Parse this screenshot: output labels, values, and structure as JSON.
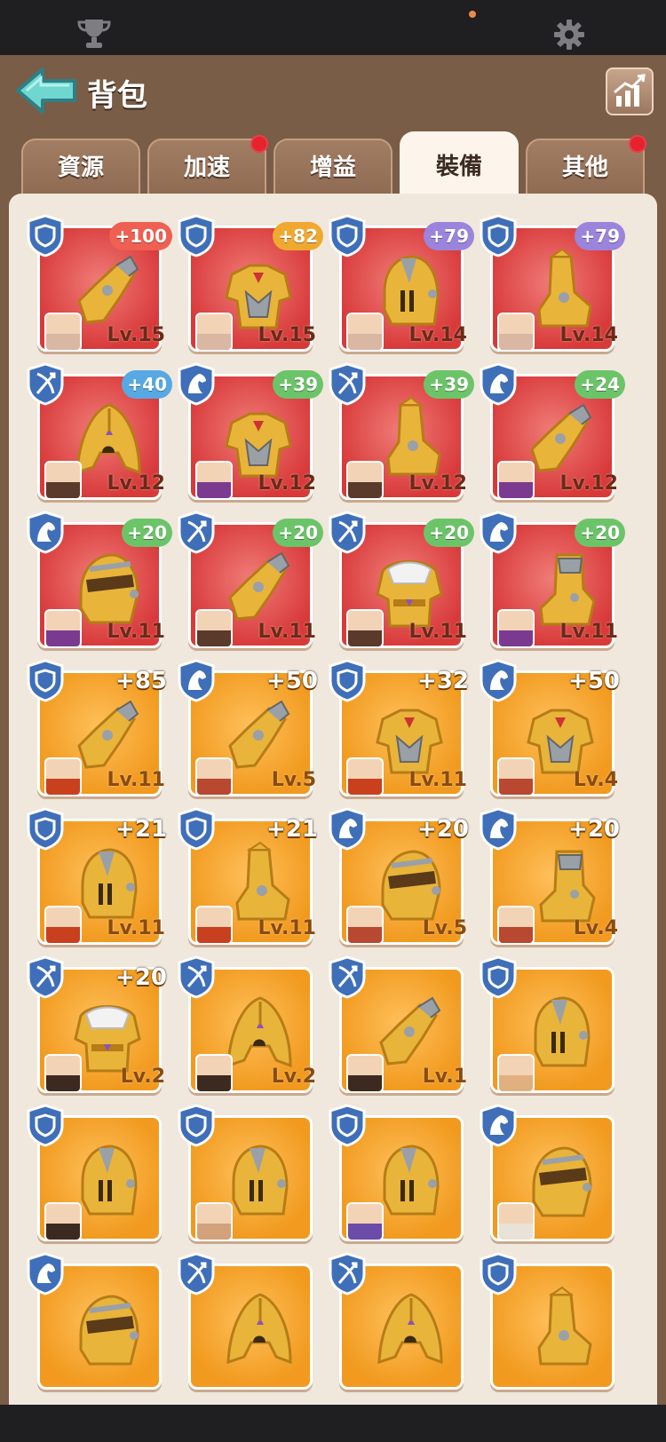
{
  "header": {
    "title": "背包"
  },
  "tabs": [
    {
      "label": "資源",
      "badge": false
    },
    {
      "label": "加速",
      "badge": true
    },
    {
      "label": "增益",
      "badge": false
    },
    {
      "label": "裝備",
      "badge": false,
      "active": true
    },
    {
      "label": "其他",
      "badge": true
    }
  ],
  "colors": {
    "accent": "#6fd7d0",
    "panel": "#7a5d47",
    "content": "#f0e7dd",
    "badge": "#e6222d"
  },
  "items": [
    {
      "role": "shield",
      "bonus": "+100",
      "bonus_style": "red",
      "level": "Lv.15",
      "rarity": "red",
      "gear": "gauntlet",
      "hero": "#d9b7a3"
    },
    {
      "role": "shield",
      "bonus": "+82",
      "bonus_style": "gold",
      "level": "Lv.15",
      "rarity": "red",
      "gear": "chest",
      "hero": "#d9b7a3"
    },
    {
      "role": "shield",
      "bonus": "+79",
      "bonus_style": "purple",
      "level": "Lv.14",
      "rarity": "red",
      "gear": "helmet",
      "hero": "#d9b7a3"
    },
    {
      "role": "shield",
      "bonus": "+79",
      "bonus_style": "purple",
      "level": "Lv.14",
      "rarity": "red",
      "gear": "boot",
      "hero": "#d9b7a3"
    },
    {
      "role": "bow",
      "bonus": "+40",
      "bonus_style": "blue",
      "level": "Lv.12",
      "rarity": "red",
      "gear": "hood",
      "hero": "#5a3a2a"
    },
    {
      "role": "horse",
      "bonus": "+39",
      "bonus_style": "green",
      "level": "Lv.12",
      "rarity": "red",
      "gear": "chest",
      "hero": "#7b3a8f"
    },
    {
      "role": "bow",
      "bonus": "+39",
      "bonus_style": "green",
      "level": "Lv.12",
      "rarity": "red",
      "gear": "boot",
      "hero": "#5a3a2a"
    },
    {
      "role": "horse",
      "bonus": "+24",
      "bonus_style": "green",
      "level": "Lv.12",
      "rarity": "red",
      "gear": "gauntlet",
      "hero": "#7b3a8f"
    },
    {
      "role": "horse",
      "bonus": "+20",
      "bonus_style": "green",
      "level": "Lv.11",
      "rarity": "red",
      "gear": "helmet2",
      "hero": "#7b3a8f"
    },
    {
      "role": "bow",
      "bonus": "+20",
      "bonus_style": "green",
      "level": "Lv.11",
      "rarity": "red",
      "gear": "gauntlet",
      "hero": "#5a3a2a"
    },
    {
      "role": "bow",
      "bonus": "+20",
      "bonus_style": "green",
      "level": "Lv.11",
      "rarity": "red",
      "gear": "chest2",
      "hero": "#5a3a2a"
    },
    {
      "role": "horse",
      "bonus": "+20",
      "bonus_style": "green",
      "level": "Lv.11",
      "rarity": "red",
      "gear": "boot2",
      "hero": "#7b3a8f"
    },
    {
      "role": "shield",
      "bonus": "+85",
      "bonus_style": "plain",
      "level": "Lv.11",
      "rarity": "orange",
      "gear": "gauntlet",
      "hero": "#c8401e"
    },
    {
      "role": "horse",
      "bonus": "+50",
      "bonus_style": "plain",
      "level": "Lv.5",
      "rarity": "orange",
      "gear": "gauntlet",
      "hero": "#b84830"
    },
    {
      "role": "shield",
      "bonus": "+32",
      "bonus_style": "plain",
      "level": "Lv.11",
      "rarity": "orange",
      "gear": "chest",
      "hero": "#c8401e"
    },
    {
      "role": "horse",
      "bonus": "+50",
      "bonus_style": "plain",
      "level": "Lv.4",
      "rarity": "orange",
      "gear": "chest",
      "hero": "#b84830"
    },
    {
      "role": "shield",
      "bonus": "+21",
      "bonus_style": "plain",
      "level": "Lv.11",
      "rarity": "orange",
      "gear": "helmet",
      "hero": "#c8401e"
    },
    {
      "role": "shield",
      "bonus": "+21",
      "bonus_style": "plain",
      "level": "Lv.11",
      "rarity": "orange",
      "gear": "boot",
      "hero": "#c8401e"
    },
    {
      "role": "horse",
      "bonus": "+20",
      "bonus_style": "plain",
      "level": "Lv.5",
      "rarity": "orange",
      "gear": "helmet2",
      "hero": "#b84830"
    },
    {
      "role": "horse",
      "bonus": "+20",
      "bonus_style": "plain",
      "level": "Lv.4",
      "rarity": "orange",
      "gear": "boot2",
      "hero": "#b84830"
    },
    {
      "role": "bow",
      "bonus": "+20",
      "bonus_style": "plain",
      "level": "Lv.2",
      "rarity": "orange",
      "gear": "chest2",
      "hero": "#3c2a20"
    },
    {
      "role": "bow",
      "bonus": "",
      "bonus_style": "plain",
      "level": "Lv.2",
      "rarity": "orange",
      "gear": "hood",
      "hero": "#3c2a20"
    },
    {
      "role": "bow",
      "bonus": "",
      "bonus_style": "plain",
      "level": "Lv.1",
      "rarity": "orange",
      "gear": "gauntlet",
      "hero": "#3c2a20"
    },
    {
      "role": "shield",
      "bonus": "",
      "bonus_style": "plain",
      "level": "",
      "rarity": "orange",
      "gear": "helmet",
      "hero": "#e0b080"
    },
    {
      "role": "shield",
      "bonus": "",
      "bonus_style": "plain",
      "level": "",
      "rarity": "orange",
      "gear": "helmet",
      "hero": "#3c2a20"
    },
    {
      "role": "shield",
      "bonus": "",
      "bonus_style": "plain",
      "level": "",
      "rarity": "orange",
      "gear": "helmet",
      "hero": "#d2a27c"
    },
    {
      "role": "shield",
      "bonus": "",
      "bonus_style": "plain",
      "level": "",
      "rarity": "orange",
      "gear": "helmet",
      "hero": "#6b4ca8"
    },
    {
      "role": "horse",
      "bonus": "",
      "bonus_style": "plain",
      "level": "",
      "rarity": "orange",
      "gear": "helmet2",
      "hero": "#e9e2d8"
    },
    {
      "role": "horse",
      "bonus": "",
      "bonus_style": "plain",
      "level": "",
      "rarity": "orange",
      "gear": "helmet2",
      "hero": ""
    },
    {
      "role": "bow",
      "bonus": "",
      "bonus_style": "plain",
      "level": "",
      "rarity": "orange",
      "gear": "hood",
      "hero": ""
    },
    {
      "role": "bow",
      "bonus": "",
      "bonus_style": "plain",
      "level": "",
      "rarity": "orange",
      "gear": "hood",
      "hero": ""
    },
    {
      "role": "shield",
      "bonus": "",
      "bonus_style": "plain",
      "level": "",
      "rarity": "orange",
      "gear": "boot",
      "hero": ""
    }
  ]
}
